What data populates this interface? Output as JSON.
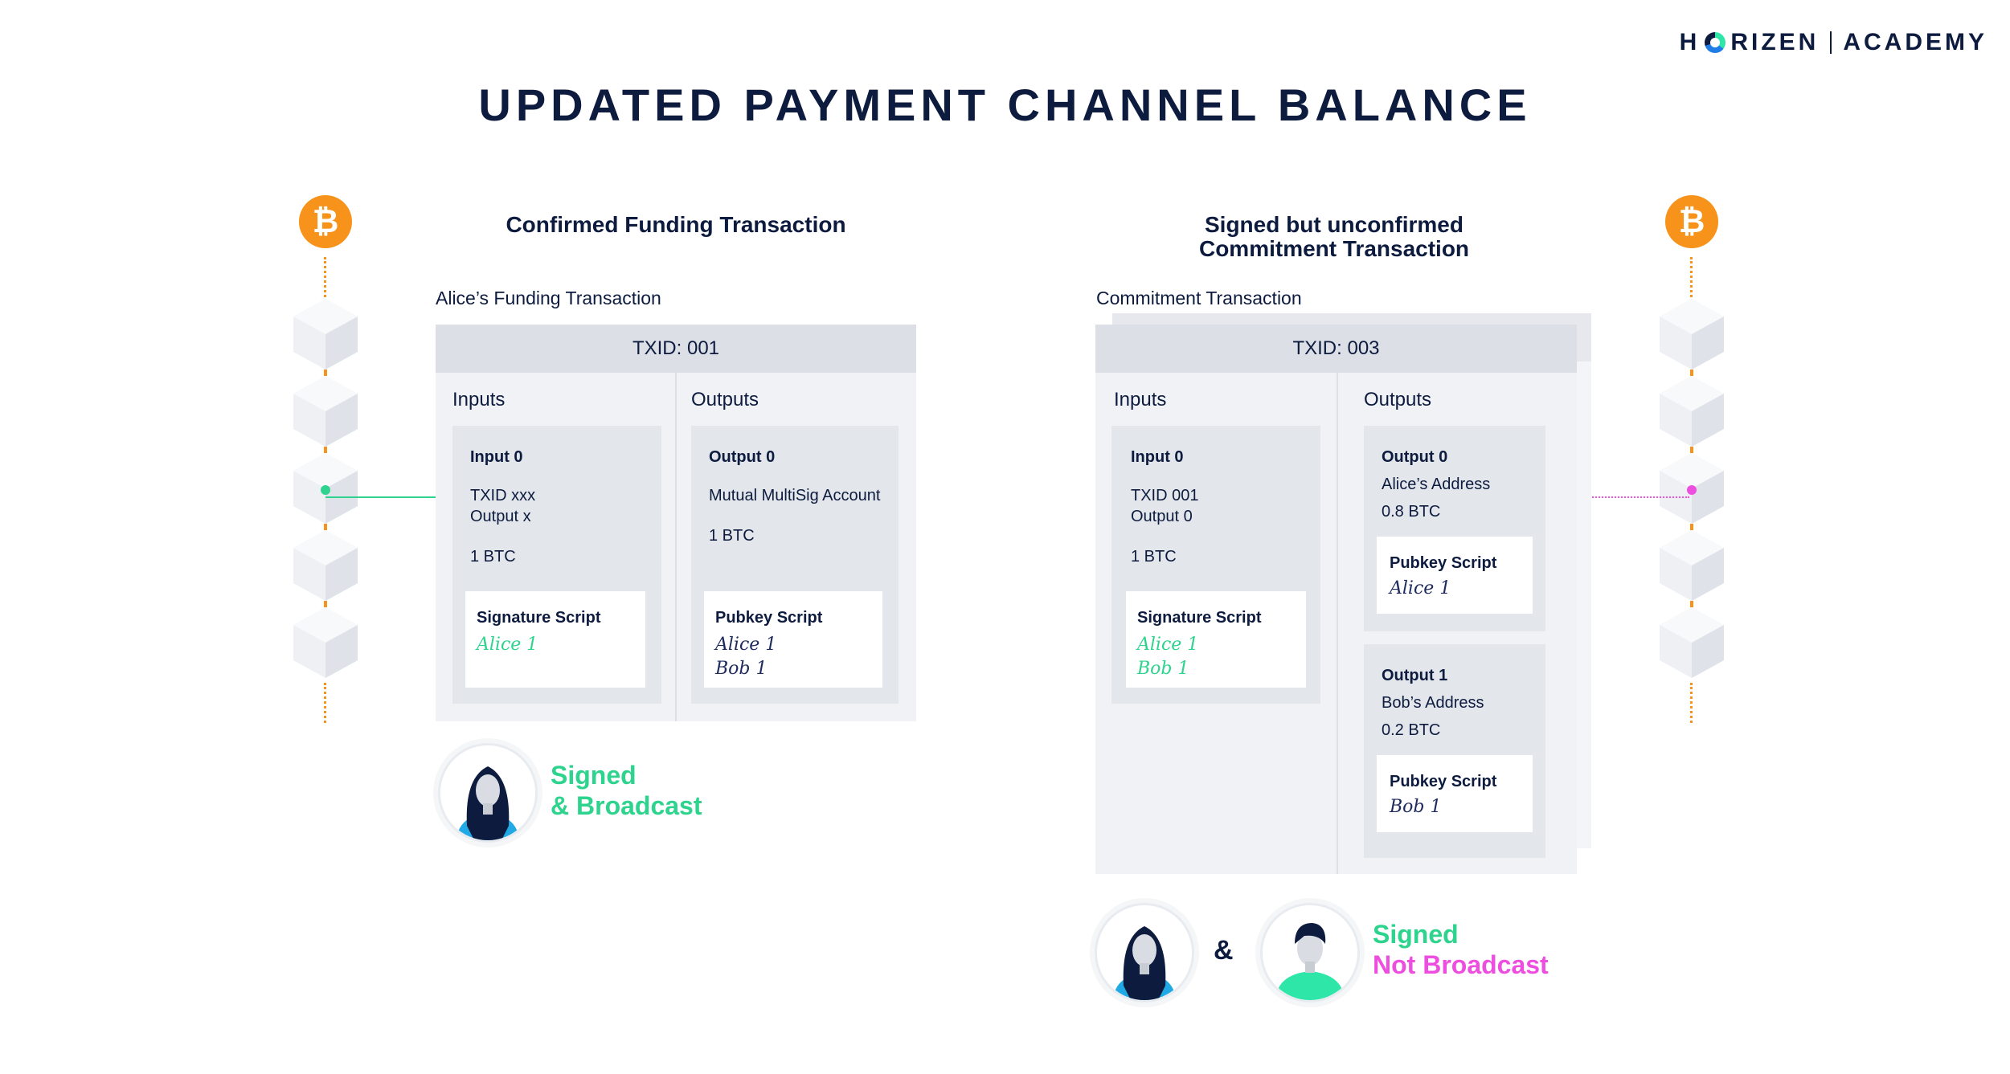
{
  "logo": {
    "left": "H",
    "ring_letter": "O",
    "right": "RIZEN",
    "academy": "ACADEMY"
  },
  "title": "UPDATED PAYMENT CHANNEL BALANCE",
  "left": {
    "section_title": "Confirmed Funding Transaction",
    "caption": "Alice’s Funding Transaction",
    "txid": "TXID: 001",
    "inputs_label": "Inputs",
    "outputs_label": "Outputs",
    "input0": {
      "label": "Input 0",
      "line1": "TXID xxx",
      "line2": "Output x",
      "amount": "1 BTC",
      "script_label": "Signature Script",
      "sig1": "Alice 1"
    },
    "output0": {
      "label": "Output 0",
      "line1": "Mutual MultiSig Account",
      "amount": "1 BTC",
      "script_label": "Pubkey Script",
      "sig1": "Alice 1",
      "sig2": "Bob 1"
    },
    "status1": "Signed",
    "status2": "& Broadcast"
  },
  "right": {
    "section_title_1": "Signed but unconfirmed",
    "section_title_2": "Commitment Transaction",
    "caption": "Commitment Transaction",
    "txid": "TXID: 003",
    "inputs_label": "Inputs",
    "outputs_label": "Outputs",
    "input0": {
      "label": "Input 0",
      "line1": "TXID 001",
      "line2": "Output 0",
      "amount": "1 BTC",
      "script_label": "Signature Script",
      "sig1": "Alice 1",
      "sig2": "Bob 1"
    },
    "output0": {
      "label": "Output 0",
      "line1": "Alice’s Address",
      "amount": "0.8 BTC",
      "script_label": "Pubkey Script",
      "sig1": "Alice 1"
    },
    "output1": {
      "label": "Output 1",
      "line1": "Bob’s Address",
      "amount": "0.2 BTC",
      "script_label": "Pubkey Script",
      "sig1": "Bob 1"
    },
    "amp": "&",
    "status1": "Signed",
    "status2": "Not Broadcast"
  },
  "coin_symbol": "₿",
  "icons": [
    "bitcoin-icon",
    "block-icon",
    "alice-avatar",
    "bob-avatar"
  ],
  "colors": {
    "navy": "#0d1b3e",
    "bitcoin": "#f7931a",
    "green": "#2ed38d",
    "pink": "#ee4ee0"
  }
}
